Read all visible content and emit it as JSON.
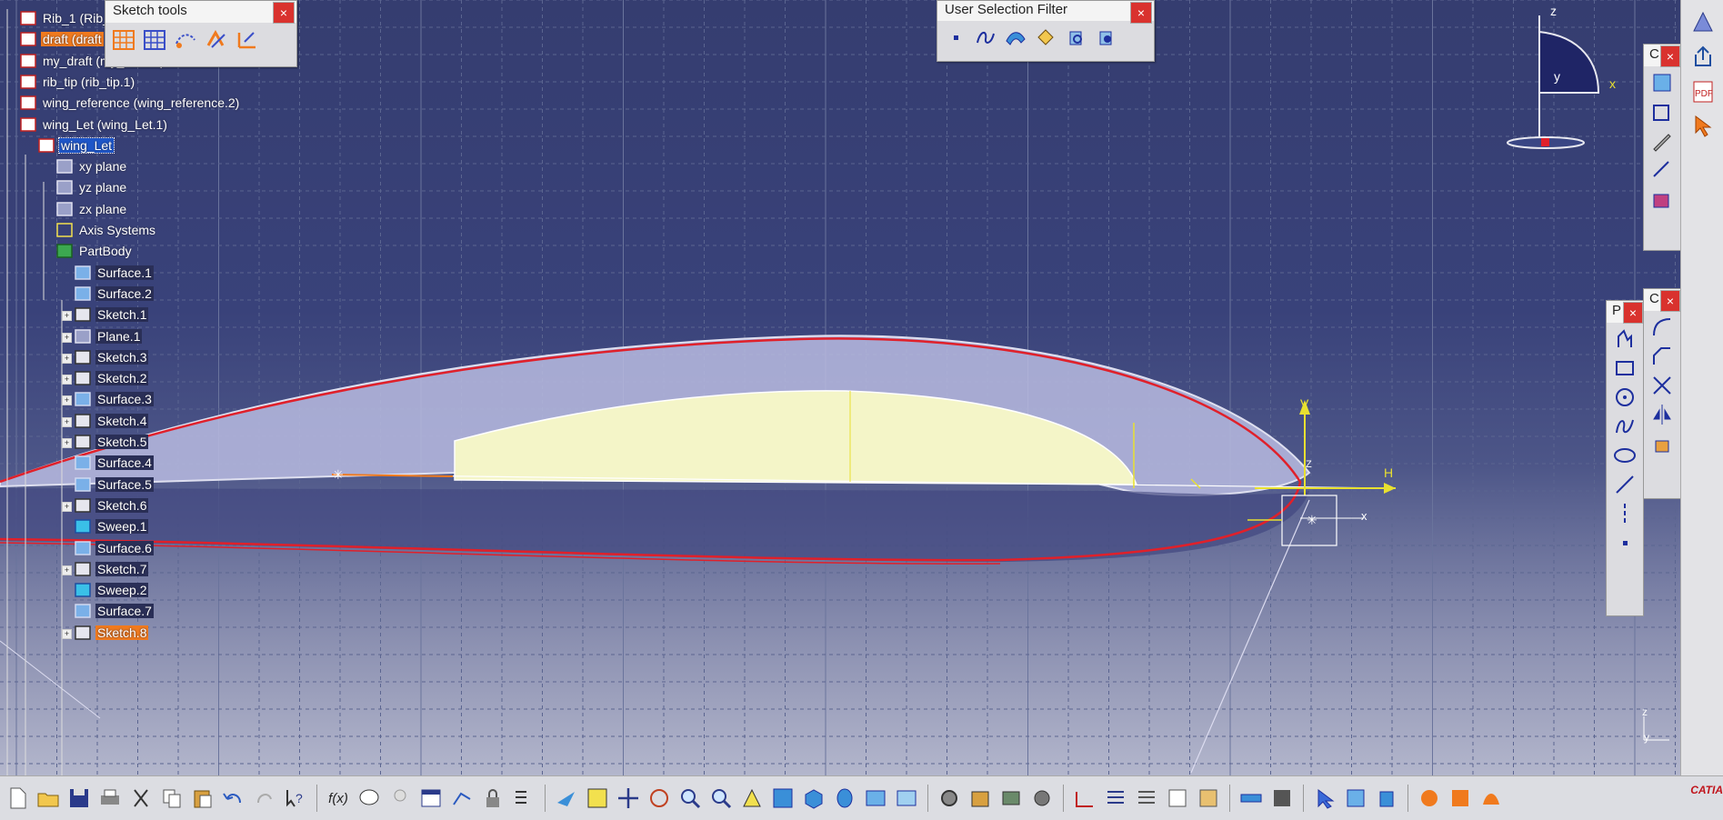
{
  "tree": {
    "nodes": [
      {
        "label": "Rib_1 (Rib_",
        "icon": "part-icon"
      },
      {
        "label": "draft (draft",
        "icon": "part-icon",
        "state": "highlight"
      },
      {
        "label": "my_draft (my_draft.1)",
        "icon": "part-icon"
      },
      {
        "label": "rib_tip (rib_tip.1)",
        "icon": "part-icon"
      },
      {
        "label": "wing_reference (wing_reference.2)",
        "icon": "part-icon"
      },
      {
        "label": "wing_Let (wing_Let.1)",
        "icon": "part-icon"
      },
      {
        "label": "wing_Let",
        "icon": "part-body-icon",
        "state": "selected"
      },
      {
        "label": "xy plane",
        "icon": "plane-icon"
      },
      {
        "label": "yz plane",
        "icon": "plane-icon"
      },
      {
        "label": "zx plane",
        "icon": "plane-icon"
      },
      {
        "label": "Axis Systems",
        "icon": "axis-system-icon"
      },
      {
        "label": "PartBody",
        "icon": "partbody-gear-icon"
      },
      {
        "label": "Surface.1",
        "icon": "surface-icon"
      },
      {
        "label": "Surface.2",
        "icon": "surface-icon"
      },
      {
        "label": "Sketch.1",
        "icon": "sketch-icon"
      },
      {
        "label": "Plane.1",
        "icon": "plane-icon"
      },
      {
        "label": "Sketch.3",
        "icon": "sketch-icon"
      },
      {
        "label": "Sketch.2",
        "icon": "sketch-icon"
      },
      {
        "label": "Surface.3",
        "icon": "surface-icon"
      },
      {
        "label": "Sketch.4",
        "icon": "sketch-icon"
      },
      {
        "label": "Sketch.5",
        "icon": "sketch-icon"
      },
      {
        "label": "Surface.4",
        "icon": "surface-icon"
      },
      {
        "label": "Surface.5",
        "icon": "surface-icon"
      },
      {
        "label": "Sketch.6",
        "icon": "sketch-icon"
      },
      {
        "label": "Sweep.1",
        "icon": "sweep-icon"
      },
      {
        "label": "Surface.6",
        "icon": "surface-icon"
      },
      {
        "label": "Sketch.7",
        "icon": "sketch-icon"
      },
      {
        "label": "Sweep.2",
        "icon": "sweep-icon"
      },
      {
        "label": "Surface.7",
        "icon": "surface-icon"
      },
      {
        "label": "Sketch.8",
        "icon": "sketch-icon",
        "state": "highlight"
      }
    ]
  },
  "sketch_tools": {
    "title": "Sketch tools",
    "close": "×",
    "buttons": [
      "grid-icon",
      "snap-to-point-icon",
      "construction-element-icon",
      "geometrical-constraints-icon",
      "dimensional-constraints-icon"
    ]
  },
  "selection_filter": {
    "title": "User Selection Filter",
    "close": "×",
    "buttons": [
      "point-filter-icon",
      "curve-filter-icon",
      "surface-filter-icon",
      "volume-filter-icon",
      "feature-element-filter-icon",
      "geometrical-element-filter-icon"
    ]
  },
  "mini_toolbars": {
    "top_right_title": "C",
    "profile_title": "P",
    "operation_title": "C",
    "close": "×"
  },
  "compass": {
    "z": "z",
    "y": "y",
    "x": "x"
  },
  "axes_labels": {
    "h": "H",
    "v": "V",
    "z": "Z",
    "x": "x"
  },
  "corner_axis": {
    "z": "z",
    "y": "y"
  },
  "colors": {
    "background": "#353d70",
    "grid": "#5b6590",
    "profile_red": "#e0202a",
    "highlight_orange": "#f07a1e",
    "selection_blue": "#1e56c8",
    "sketch_yellow": "#e8e030"
  },
  "bottom_bar": {
    "formula_label": "f(x)",
    "logo_text": "CATIA"
  }
}
